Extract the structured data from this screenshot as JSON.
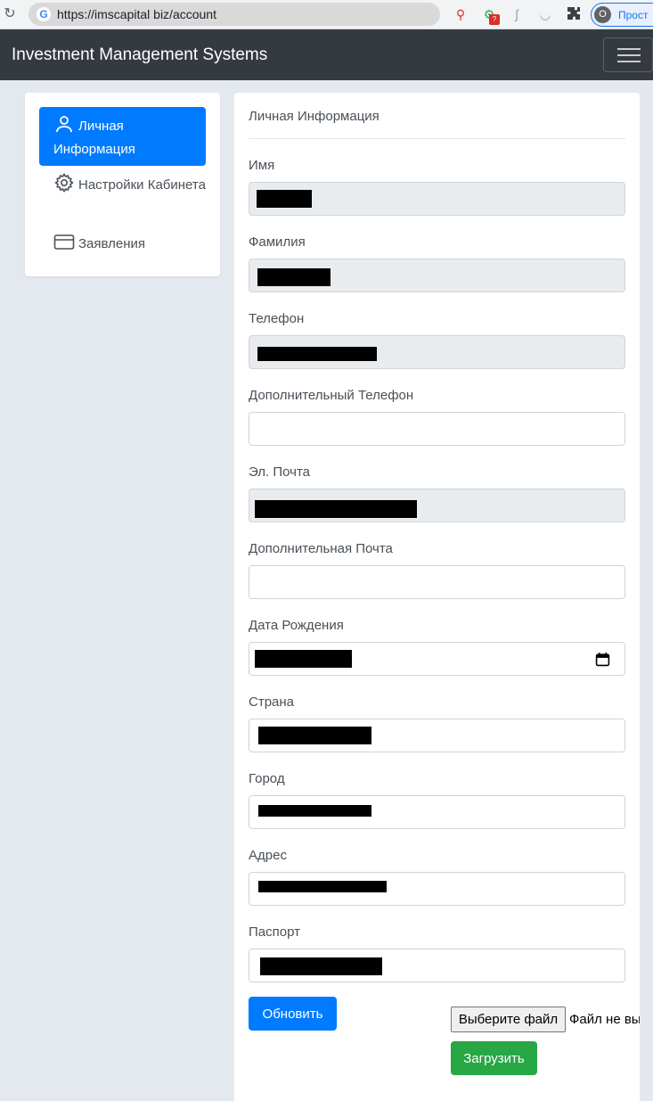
{
  "browser": {
    "url": "https://imscapital biz/account",
    "profile_initial": "O",
    "profile_label": "Прост",
    "ext_badge": "?"
  },
  "navbar": {
    "brand": "Investment Management Systems"
  },
  "sidebar": {
    "items": [
      {
        "label": "Личная Информация",
        "icon": "user-icon",
        "active": true
      },
      {
        "label": "Настройки Кабинета",
        "icon": "gear-icon",
        "active": false
      },
      {
        "label": "Заявления",
        "icon": "card-icon",
        "active": false
      }
    ]
  },
  "form": {
    "title": "Личная Информация",
    "fields": {
      "first_name": {
        "label": "Имя"
      },
      "last_name": {
        "label": "Фамилия"
      },
      "phone": {
        "label": "Телефон"
      },
      "extra_phone": {
        "label": "Дополнительный Телефон"
      },
      "email": {
        "label": "Эл. Почта"
      },
      "extra_email": {
        "label": "Дополнительная Почта"
      },
      "birth_date": {
        "label": "Дата Рождения"
      },
      "country": {
        "label": "Страна"
      },
      "city": {
        "label": "Город"
      },
      "address": {
        "label": "Адрес"
      },
      "passport": {
        "label": "Паспорт"
      }
    },
    "update_label": "Обновить",
    "choose_file_label": "Выберите файл",
    "file_status": "Файл не выбран",
    "upload_label": "Загрузить"
  },
  "colors": {
    "primary": "#007bff",
    "success": "#28a745",
    "navbar": "#343a40",
    "page_bg": "#e4e9f0"
  }
}
